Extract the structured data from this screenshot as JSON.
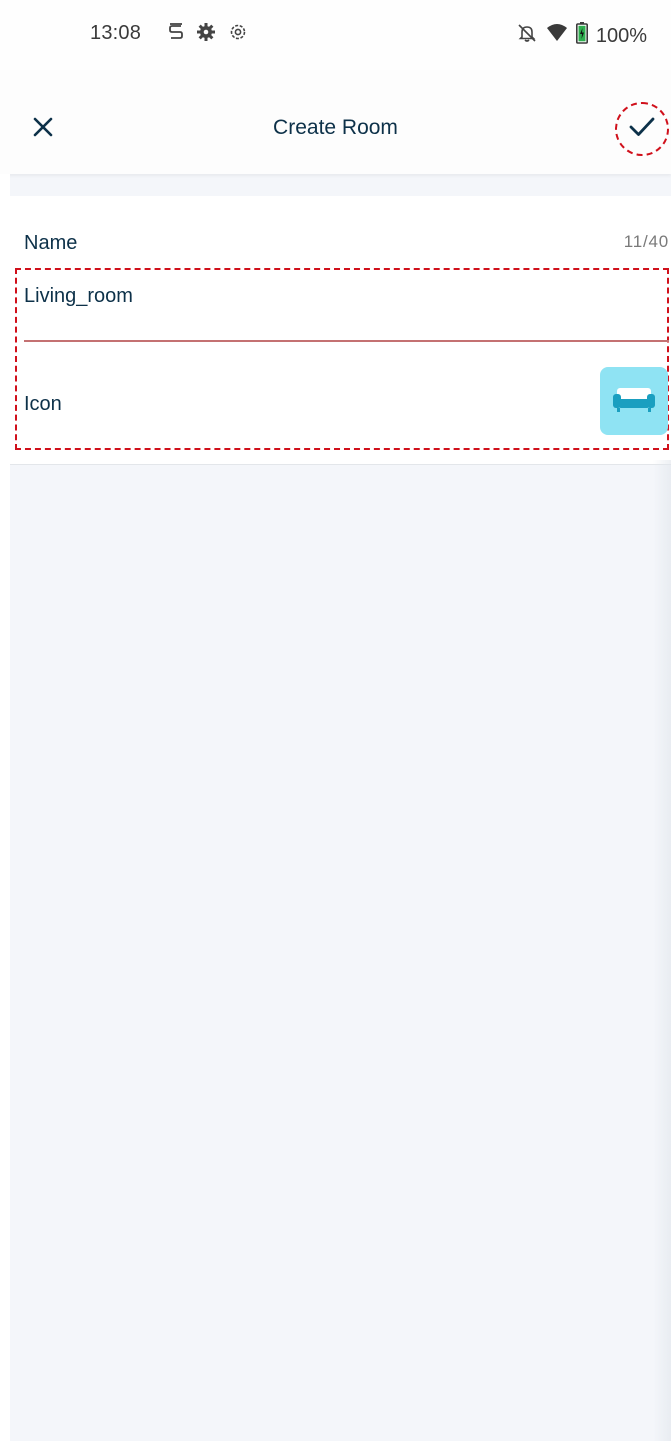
{
  "status_bar": {
    "time": "13:08",
    "battery": "100%",
    "left_icons": [
      "s-icon",
      "settings-solid-icon",
      "settings-outline-icon"
    ],
    "right_icons": [
      "notifications-off-icon",
      "wifi-icon",
      "battery-icon"
    ]
  },
  "app_bar": {
    "title": "Create Room",
    "close_icon": "close-icon",
    "confirm_icon": "check-icon"
  },
  "form": {
    "name_label": "Name",
    "counter": "11/40",
    "name_value": "Living_room",
    "icon_label": "Icon",
    "icon_name": "sofa-icon"
  },
  "colors": {
    "title": "#0d3149",
    "underline": "#c47172",
    "icon_bg": "#8fe3f3",
    "icon_fg": "#1a9fc0",
    "highlight": "#d0101b"
  }
}
